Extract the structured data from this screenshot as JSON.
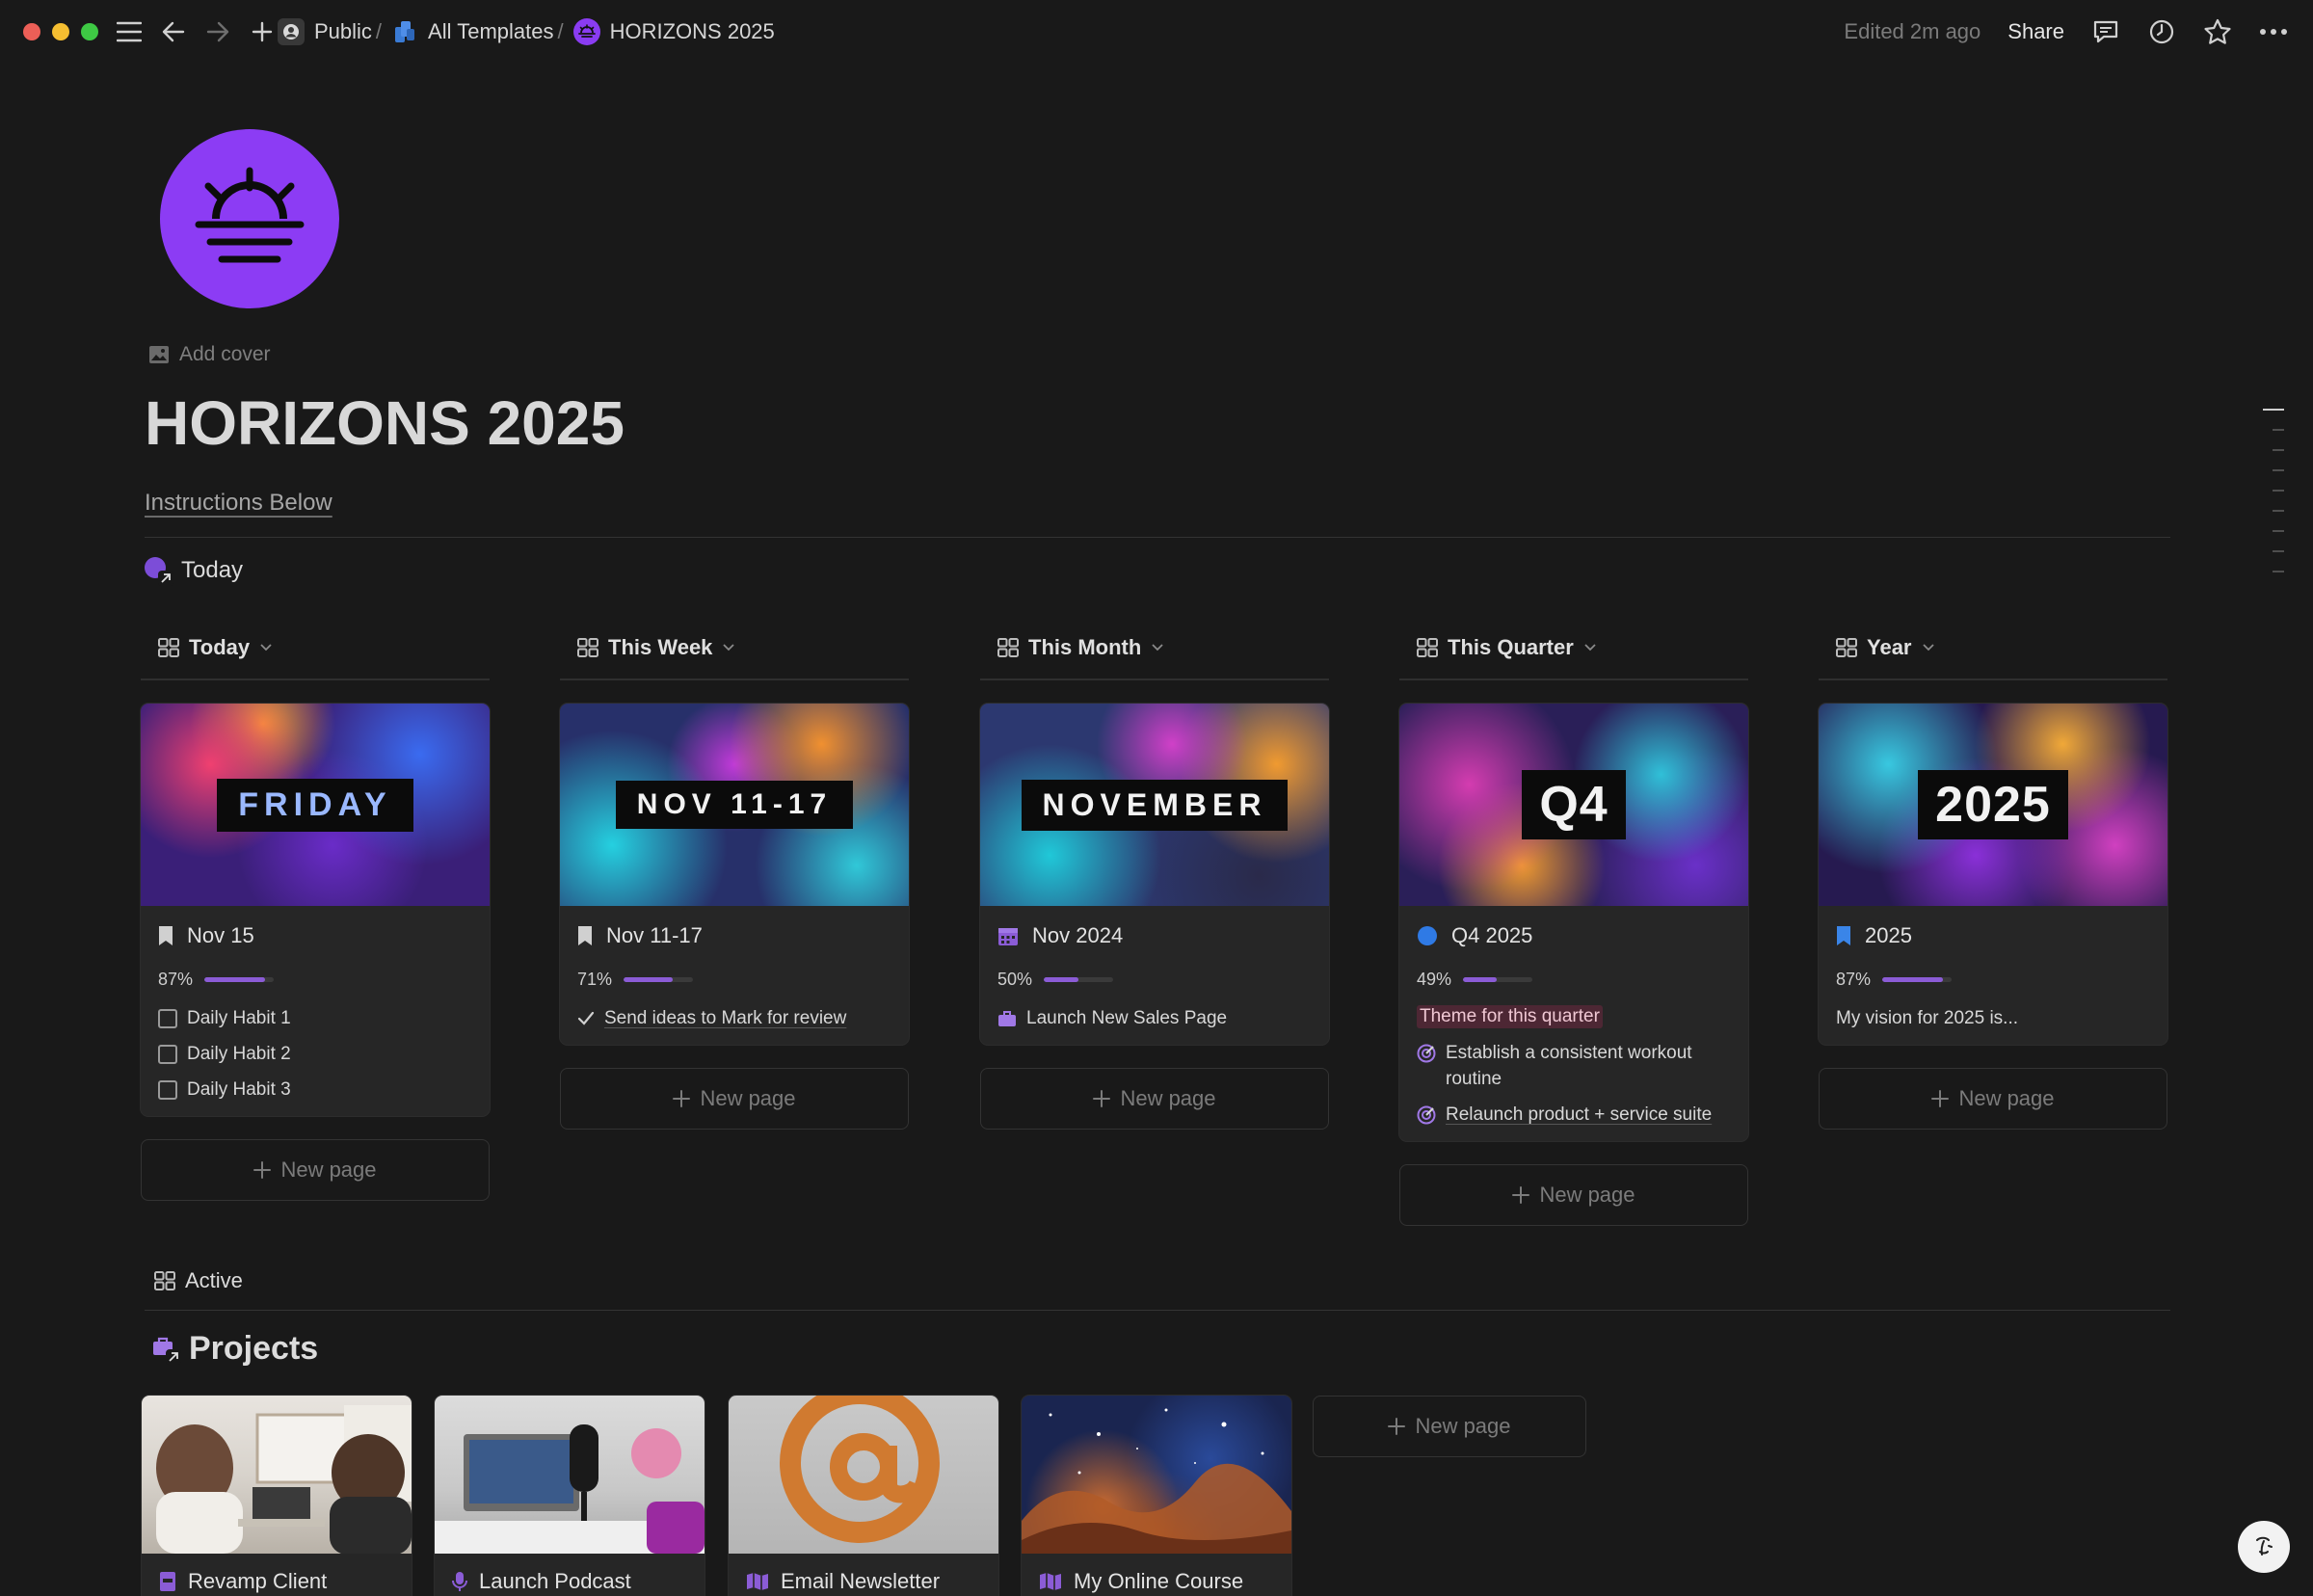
{
  "window": {
    "title": "HORIZONS 2025"
  },
  "breadcrumbs": {
    "public": "Public",
    "templates": "All Templates",
    "current": "HORIZONS 2025"
  },
  "topbar": {
    "edited": "Edited 2m ago",
    "share": "Share"
  },
  "header": {
    "add_cover": "Add cover",
    "title": "HORIZONS 2025",
    "instructions": "Instructions Below"
  },
  "today_section": {
    "label": "Today"
  },
  "columns": [
    {
      "tab": "Today",
      "cover_text": "FRIDAY",
      "card_title": "Nov 15",
      "progress_label": "87%",
      "progress": 0.87,
      "items": [
        "Daily Habit 1",
        "Daily Habit 2",
        "Daily Habit 3"
      ],
      "new_page": "New page"
    },
    {
      "tab": "This Week",
      "cover_text": "NOV 11-17",
      "card_title": "Nov 11-17",
      "progress_label": "71%",
      "progress": 0.71,
      "items": [
        "Send ideas to Mark for review"
      ],
      "new_page": "New page"
    },
    {
      "tab": "This Month",
      "cover_text": "NOVEMBER",
      "card_title": "Nov 2024",
      "progress_label": "50%",
      "progress": 0.5,
      "items": [
        "Launch New Sales Page"
      ],
      "new_page": "New page"
    },
    {
      "tab": "This Quarter",
      "cover_text": "Q4",
      "card_title": "Q4 2025",
      "progress_label": "49%",
      "progress": 0.49,
      "theme": "Theme for this quarter",
      "items": [
        "Establish a consistent workout routine",
        "Relaunch product + service suite"
      ],
      "new_page": "New page"
    },
    {
      "tab": "Year",
      "cover_text": "2025",
      "card_title": "2025",
      "progress_label": "87%",
      "progress": 0.87,
      "items": [
        "My vision for 2025 is..."
      ],
      "new_page": "New page"
    }
  ],
  "active_view": {
    "label": "Active"
  },
  "projects": {
    "title": "Projects",
    "items": [
      {
        "title": "Revamp Client"
      },
      {
        "title": "Launch Podcast"
      },
      {
        "title": "Email Newsletter"
      },
      {
        "title": "My Online Course"
      }
    ],
    "new_page": "New page"
  },
  "colors": {
    "accent": "#8c3cf4",
    "progress": "#8b5cd6",
    "background": "#191919",
    "card": "#262626",
    "theme_tag": "#4d2734"
  }
}
